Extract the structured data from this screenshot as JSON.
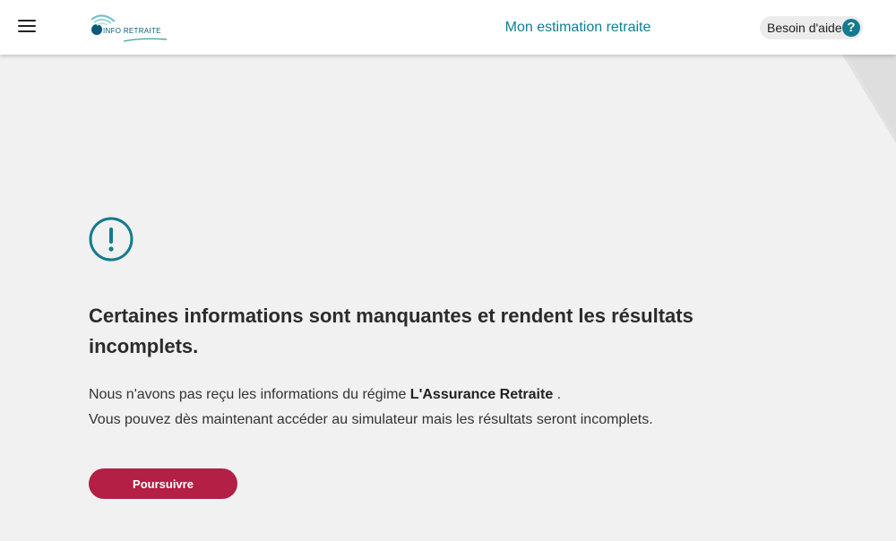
{
  "header": {
    "menu_icon": "hamburger-menu-icon",
    "logo_text": "INFO RETRAITE",
    "title": "Mon estimation retraite",
    "help_label": "Besoin d'aide",
    "help_icon_glyph": "?"
  },
  "main": {
    "alert_icon": "exclamation-circle-icon",
    "heading": "Certaines informations sont manquantes et rendent les résultats incomplets.",
    "desc_line1_prefix": "Nous n'avons pas reçu les informations du régime ",
    "desc_line1_bold": "L'Assurance Retraite",
    "desc_line1_suffix": " .",
    "desc_line2": "Vous pouvez dès maintenant accéder au simulateur mais les résultats seront incomplets.",
    "continue_label": "Poursuivre"
  },
  "colors": {
    "accent_teal": "#0f7f93",
    "button_red": "#b31f45",
    "background": "#f1f1f1"
  }
}
